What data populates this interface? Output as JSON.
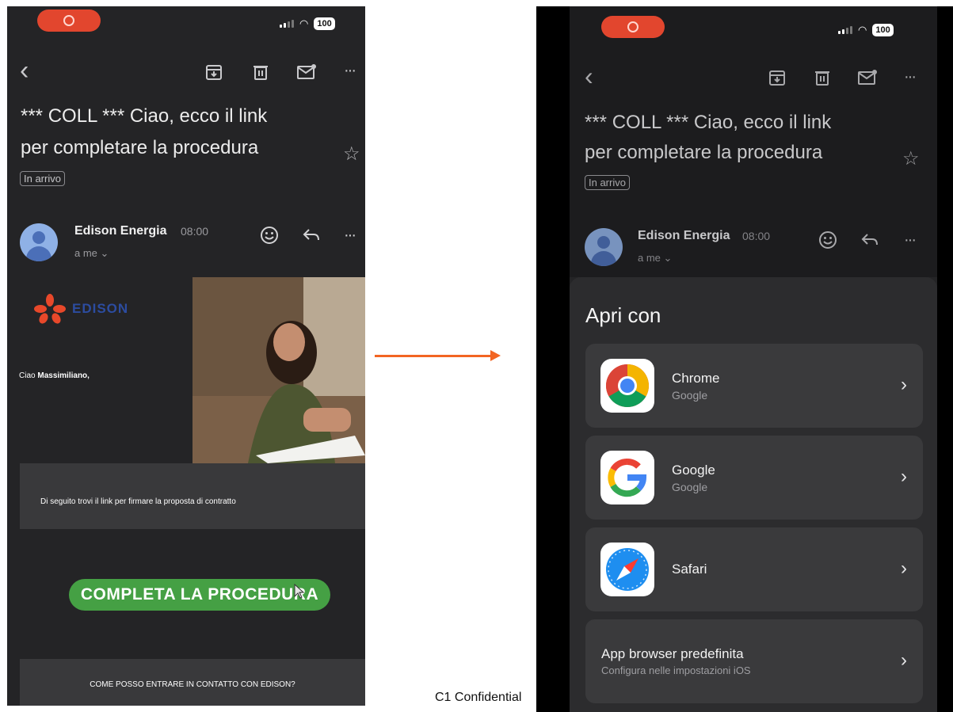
{
  "left": {
    "status": {
      "battery": "100"
    },
    "subject_line1": "*** COLL ***  Ciao, ecco il link",
    "subject_line2": "per completare la procedura",
    "label": "In arrivo",
    "sender": "Edison Energia",
    "time": "08:00",
    "to": "a me ⌄",
    "logo_text": "EDISON",
    "greeting_prefix": "Ciao ",
    "greeting_name": "Massimiliano,",
    "body_text": "Di seguito trovi il link per firmare la proposta di contratto",
    "cta_label": "COMPLETA LA PROCEDURA",
    "contact_text": "COME POSSO ENTRARE IN CONTATTO CON EDISON?"
  },
  "footer_text": "C1 Confidential",
  "right": {
    "status": {
      "battery": "100"
    },
    "subject_line1": "*** COLL ***  Ciao, ecco il link",
    "subject_line2": "per completare la procedura",
    "label": "In arrivo",
    "sender": "Edison Energia",
    "time": "08:00",
    "to": "a me ⌄",
    "sheet_title": "Apri con",
    "options": [
      {
        "name": "Chrome",
        "sub": "Google",
        "icon": "chrome-icon"
      },
      {
        "name": "Google",
        "sub": "Google",
        "icon": "google-icon"
      },
      {
        "name": "Safari",
        "sub": "",
        "icon": "safari-icon"
      },
      {
        "name": "App browser predefinita",
        "sub": "Configura nelle impostazioni iOS",
        "icon": ""
      }
    ]
  },
  "icons": {
    "back": "‹",
    "archive": "archive-icon",
    "delete": "trash-icon",
    "mark_unread": "mail-unread-icon",
    "more": "···",
    "star": "☆",
    "emoji": "☺",
    "reply": "↩",
    "chevron": "›"
  },
  "colors": {
    "accent_arrow": "#f26522",
    "cta": "#45a044",
    "record_pill": "#e2462e"
  }
}
